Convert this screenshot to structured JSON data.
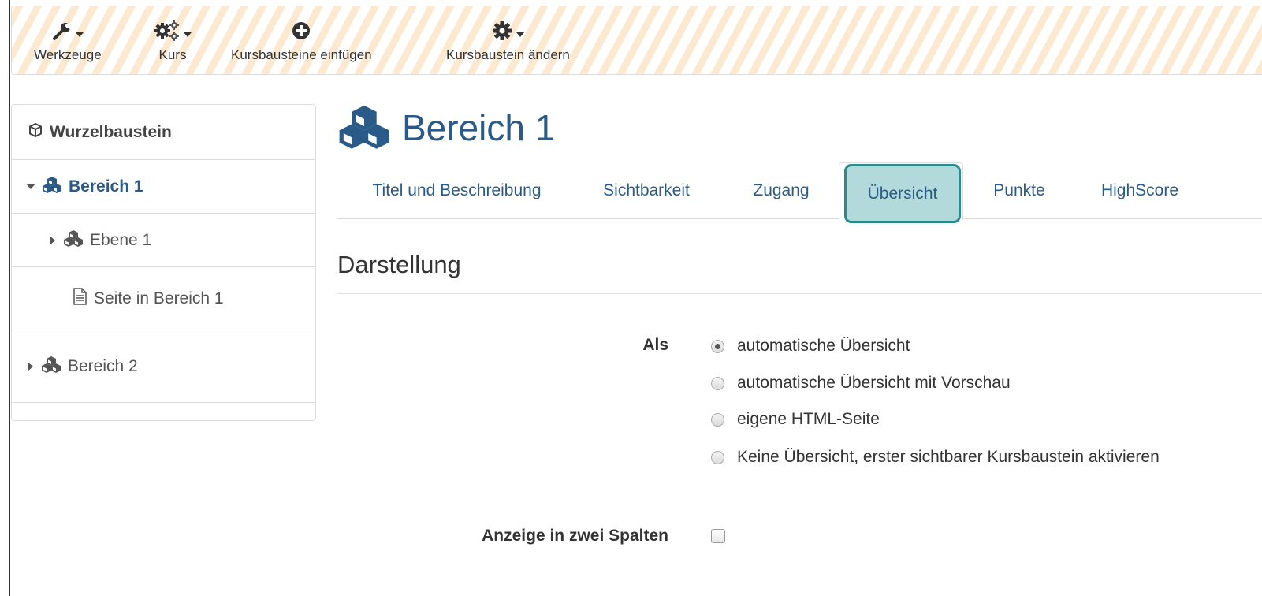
{
  "toolbar": {
    "items": [
      {
        "label": "Werkzeuge",
        "icon": "wrench-icon"
      },
      {
        "label": "Kurs",
        "icon": "gears-icon"
      },
      {
        "label": "Kursbausteine einfügen",
        "icon": "plus-circle-icon"
      },
      {
        "label": "Kursbaustein ändern",
        "icon": "gear-icon"
      }
    ]
  },
  "sidebar": {
    "items": [
      {
        "label": "Wurzelbaustein",
        "icon": "cube-icon"
      },
      {
        "label": "Bereich 1",
        "icon": "cubes-icon"
      },
      {
        "label": "Ebene 1",
        "icon": "cubes-icon"
      },
      {
        "label": "Seite in Bereich 1",
        "icon": "file-text-icon"
      },
      {
        "label": "Bereich 2",
        "icon": "cubes-icon"
      }
    ]
  },
  "main": {
    "title": "Bereich 1",
    "tabs": [
      {
        "label": "Titel und Beschreibung"
      },
      {
        "label": "Sichtbarkeit"
      },
      {
        "label": "Zugang"
      },
      {
        "label": "Übersicht",
        "active": true
      },
      {
        "label": "Punkte"
      },
      {
        "label": "HighScore"
      }
    ],
    "section_title": "Darstellung",
    "form": {
      "als_label": "Als",
      "options": [
        {
          "label": "automatische Übersicht",
          "checked": true
        },
        {
          "label": "automatische Übersicht mit Vorschau",
          "checked": false
        },
        {
          "label": "eigene HTML-Seite",
          "checked": false
        },
        {
          "label": "Keine Übersicht, erster sichtbarer Kursbaustein aktivieren",
          "checked": false
        }
      ],
      "two_columns_label": "Anzeige in zwei Spalten",
      "two_columns_checked": false
    }
  },
  "colors": {
    "accent": "#2a5a87",
    "highlight_bg": "#b3dada",
    "highlight_border": "#2e8a8a",
    "toolbar_stripe": "#fde9cf"
  }
}
